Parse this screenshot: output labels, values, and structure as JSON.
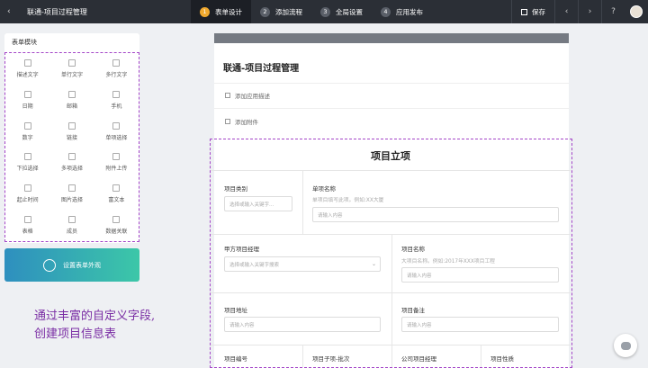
{
  "topbar": {
    "title": "联通-项目过程管理",
    "steps": [
      {
        "num": "1",
        "label": "表单设计"
      },
      {
        "num": "2",
        "label": "添加流程"
      },
      {
        "num": "3",
        "label": "全局设置"
      },
      {
        "num": "4",
        "label": "应用发布"
      }
    ],
    "save_label": "保存"
  },
  "left_panel": {
    "title": "表单模块",
    "widgets": [
      "描述文字",
      "单行文字",
      "多行文字",
      "日期",
      "邮箱",
      "手机",
      "数字",
      "链接",
      "单项选择",
      "下拉选择",
      "多项选择",
      "附件上传",
      "起止时间",
      "图片选择",
      "富文本",
      "表格",
      "成员",
      "数据关联"
    ],
    "appearance_label": "设置表单外观"
  },
  "caption": [
    "通过丰富的自定义字段,",
    "创建项目信息表"
  ],
  "form": {
    "title": "联通-项目过程管理",
    "add_desc": "添加应用描述",
    "add_attach": "添加附件",
    "section_title": "项目立项",
    "fields": {
      "category": {
        "label": "项目类别",
        "placeholder": "选择或输入关键字..."
      },
      "item_name": {
        "label": "单项名称",
        "hint": "单项目填写此项。例如:XX大厦",
        "placeholder": "请输入内容"
      },
      "party_manager": {
        "label": "甲方项目经理",
        "placeholder": "选择或输入关键字搜索"
      },
      "project_name": {
        "label": "项目名称",
        "hint": "大项目名称。例如:2017年XXX项目工程",
        "placeholder": "请输入内容"
      },
      "address": {
        "label": "项目地址",
        "placeholder": "请输入内容"
      },
      "remark": {
        "label": "项目备注",
        "placeholder": "请输入内容"
      },
      "number": {
        "label": "项目编号"
      },
      "sub_batch": {
        "label": "项目子项-批次"
      },
      "company_manager": {
        "label": "公司项目经理"
      },
      "nature": {
        "label": "项目性质"
      }
    }
  }
}
